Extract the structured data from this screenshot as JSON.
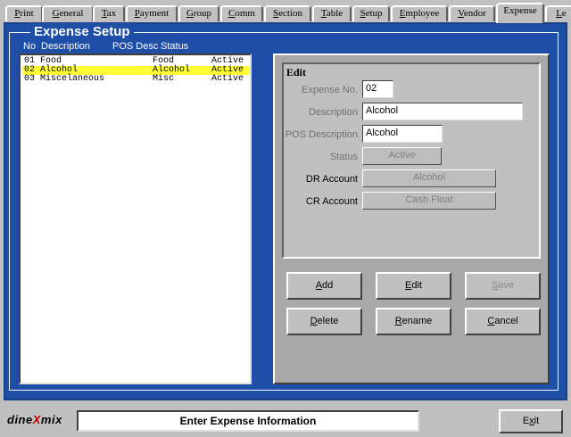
{
  "tabs": [
    {
      "label": "Print",
      "key": "P",
      "rest": "rint"
    },
    {
      "label": "General",
      "key": "G",
      "rest": "eneral"
    },
    {
      "label": "Tax",
      "key": "T",
      "rest": "ax"
    },
    {
      "label": "Payment",
      "key": "P",
      "rest": "ayment"
    },
    {
      "label": "Group",
      "key": "G",
      "rest": "roup"
    },
    {
      "label": "Comm",
      "key": "C",
      "rest": "omm"
    },
    {
      "label": "Section",
      "key": "S",
      "rest": "ection"
    },
    {
      "label": "Table",
      "key": "T",
      "rest": "able"
    },
    {
      "label": "Setup",
      "key": "S",
      "rest": "etup"
    },
    {
      "label": "Employee",
      "key": "E",
      "rest": "mployee"
    },
    {
      "label": "Vendor",
      "key": "V",
      "rest": "endor"
    },
    {
      "label": "Expense",
      "key": "",
      "rest": "Expense"
    },
    {
      "label": "Le",
      "key": "L",
      "rest": "e"
    }
  ],
  "active_tab": "Expense",
  "panel_title": "Expense Setup",
  "columns": {
    "no": "No",
    "description": "Description",
    "pos_desc": "POS Desc",
    "status": "Status"
  },
  "rows": [
    {
      "no": "01",
      "description": "Food",
      "pos_desc": "Food",
      "status": "Active",
      "selected": false
    },
    {
      "no": "02",
      "description": "Alcohol",
      "pos_desc": "Alcohol",
      "status": "Active",
      "selected": true
    },
    {
      "no": "03",
      "description": "Miscelaneous",
      "pos_desc": "Misc",
      "status": "Active",
      "selected": false
    }
  ],
  "edit": {
    "title": "Edit",
    "expense_no_label": "Expense No.",
    "expense_no": "02",
    "description_label": "Description",
    "description": "Alcohol",
    "pos_description_label": "POS Description",
    "pos_description": "Alcohol",
    "status_label": "Status",
    "status": "Active",
    "dr_account_label": "DR Account",
    "dr_account": "Alcohol",
    "cr_account_label": "CR Account",
    "cr_account": "Cash Float"
  },
  "buttons": {
    "add": {
      "key": "A",
      "rest": "dd"
    },
    "edit": {
      "key": "E",
      "rest": "dit"
    },
    "save": {
      "key": "S",
      "rest": "ave"
    },
    "delete": {
      "key": "D",
      "rest": "elete"
    },
    "rename": {
      "key": "R",
      "rest": "ename"
    },
    "cancel": {
      "key": "C",
      "rest": "ancel"
    }
  },
  "logo": {
    "part1": "dine",
    "part2": "X",
    "part3": "mix"
  },
  "status_message": "Enter Expense Information",
  "exit": {
    "pre": "E",
    "key": "x",
    "rest": "it"
  }
}
